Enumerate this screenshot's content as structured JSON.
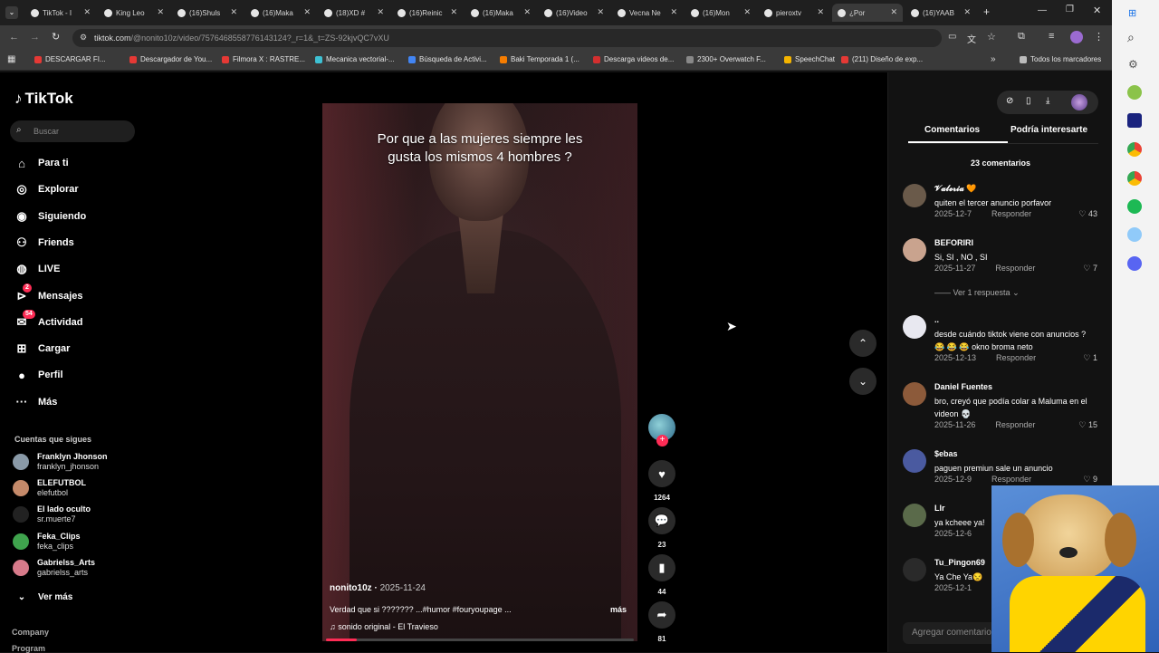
{
  "tabs": [
    {
      "label": "TikTok - I"
    },
    {
      "label": "King Leo"
    },
    {
      "label": "(16)Shuls"
    },
    {
      "label": "(16)Maka"
    },
    {
      "label": "(18)XD #"
    },
    {
      "label": "(16)Reinic"
    },
    {
      "label": "(16)Maka"
    },
    {
      "label": "(16)Video"
    },
    {
      "label": "Vecna Ne"
    },
    {
      "label": "(16)Mon"
    },
    {
      "label": "pieroxtv"
    },
    {
      "label": "¿Por"
    },
    {
      "label": "(16)YAAB"
    }
  ],
  "address": {
    "host": "tiktok.com",
    "path": "/@nonito10z/video/7576468558776143124?_r=1&_t=ZS-92kjvQC7vXU"
  },
  "bookmarks": [
    {
      "label": "DESCARGAR FI...",
      "color": "#e53935"
    },
    {
      "label": "Descargador de You...",
      "color": "#e53935"
    },
    {
      "label": "Filmora X : RASTRE...",
      "color": "#e53935"
    },
    {
      "label": "Mecanica vectorial-...",
      "color": "#3ec1d3"
    },
    {
      "label": "Búsqueda de Activi...",
      "color": "#4285f4"
    },
    {
      "label": "Baki Temporada 1 (...",
      "color": "#f57c00"
    },
    {
      "label": "Descarga videos de...",
      "color": "#d32f2f"
    },
    {
      "label": "2300+ Overwatch F...",
      "color": "#888888"
    },
    {
      "label": "SpeechChat",
      "color": "#f4b400"
    },
    {
      "label": "(211) Diseño de exp...",
      "color": "#e53935"
    }
  ],
  "bookmarks_all": "Todos los marcadores",
  "brand": {
    "name": "TikTok"
  },
  "search": {
    "placeholder": "Buscar"
  },
  "nav": [
    {
      "label": "Para ti",
      "icon": "home-icon"
    },
    {
      "label": "Explorar",
      "icon": "compass-icon"
    },
    {
      "label": "Siguiendo",
      "icon": "following-icon"
    },
    {
      "label": "Friends",
      "icon": "friends-icon"
    },
    {
      "label": "LIVE",
      "icon": "live-icon"
    },
    {
      "label": "Mensajes",
      "icon": "messages-icon",
      "badge": "2"
    },
    {
      "label": "Actividad",
      "icon": "activity-icon",
      "badge": "54"
    },
    {
      "label": "Cargar",
      "icon": "upload-icon"
    },
    {
      "label": "Perfil",
      "icon": "profile-icon"
    },
    {
      "label": "Más",
      "icon": "more-icon"
    }
  ],
  "following": {
    "title": "Cuentas que sigues",
    "accounts": [
      {
        "name": "Franklyn Jhonson",
        "handle": "franklyn_jhonson"
      },
      {
        "name": "ELEFUTBOL",
        "handle": "elefutbol"
      },
      {
        "name": "El lado oculto",
        "handle": "sr.muerte7"
      },
      {
        "name": "Feka_Clips",
        "handle": "feka_clips"
      },
      {
        "name": "Gabrielss_Arts",
        "handle": "gabrielss_arts"
      }
    ],
    "more": "Ver más"
  },
  "footer": {
    "company": "Company",
    "program": "Program"
  },
  "video": {
    "caption": "Por que a las mujeres siempre les gusta los mismos 4 hombres ?",
    "author": "nonito10z",
    "date": "2025-11-24",
    "description": "Verdad que si ??????? ...#humor #fouryoupage ...",
    "more": "más",
    "music": "sonido original - El Travieso",
    "progress": 0.1
  },
  "actions": {
    "likes": "1264",
    "comments": "23",
    "saves": "44",
    "shares": "81"
  },
  "panel": {
    "tabs": [
      "Comentarios",
      "Podría interesarte"
    ],
    "count": "23 comentarios",
    "reply_label": "Responder",
    "view_replies": "Ver 1 respuesta",
    "add_comment": "Agregar comentario...",
    "comments": [
      {
        "name": "𝓥𝓪𝓵𝓮𝓻𝓲𝓪 🧡",
        "text": "quiten el tercer anuncio porfavor",
        "date": "2025-12-7",
        "likes": "43",
        "color": "#6a5a4a"
      },
      {
        "name": "BEFORIRI",
        "text": "Si, SI , NO , SI",
        "date": "2025-11-27",
        "likes": "7",
        "color": "#c9a38e"
      },
      {
        "name": "..",
        "text": "desde cuándo tiktok viene con anuncios ? 😂 😂 😂 okno broma neto",
        "date": "2025-12-13",
        "likes": "1",
        "color": "#e8e8f0"
      },
      {
        "name": "Daniel Fuentes",
        "text": "bro, creyó que podía colar a Maluma en el videon 💀",
        "date": "2025-11-26",
        "likes": "15",
        "color": "#8c5a3a"
      },
      {
        "name": "$ebas",
        "text": "paguen premiun sale un anuncio",
        "date": "2025-12-9",
        "likes": "9",
        "color": "#4a5aa0"
      },
      {
        "name": "Llr",
        "text": "ya kcheee ya!",
        "date": "2025-12-6",
        "likes": "",
        "color": "#5a6a4a"
      },
      {
        "name": "Tu_Pingon69",
        "text": "Ya Che Ya😒",
        "date": "2025-12-1",
        "likes": "",
        "color": "#2a2a2a"
      }
    ]
  }
}
